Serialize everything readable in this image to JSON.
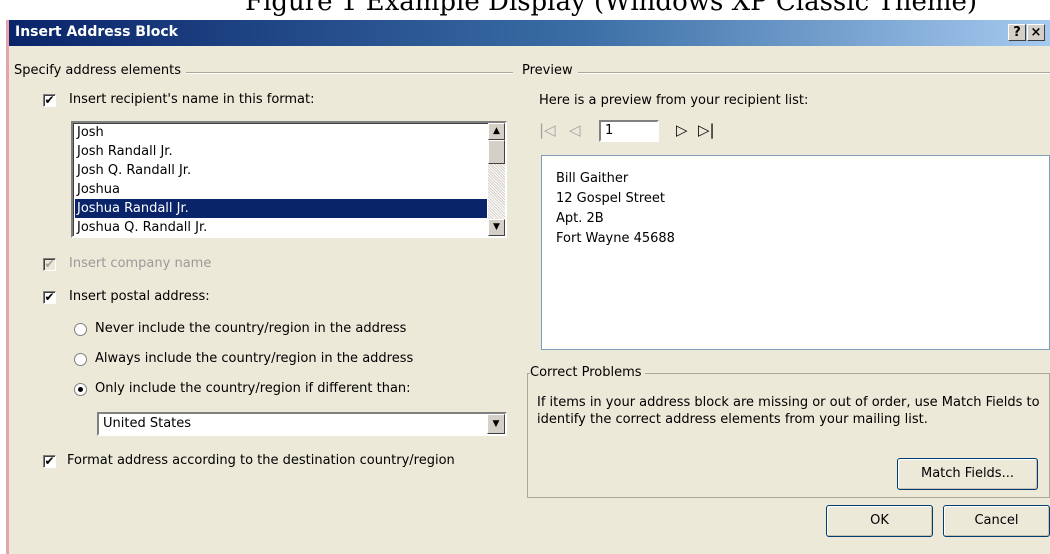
{
  "top_caption": "Figure 1 Example Display (Windows XP Classic Theme)",
  "window": {
    "title": "Insert Address Block",
    "help_button": "?",
    "close_button": "×"
  },
  "elements_group": {
    "label": "Specify address elements",
    "recipient_name_checkbox": {
      "checked": true,
      "label": "Insert recipient's name in this format:"
    },
    "name_formats": [
      "Josh",
      "Josh Randall Jr.",
      "Josh Q. Randall Jr.",
      "Joshua",
      "Joshua Randall Jr.",
      "Joshua Q. Randall Jr."
    ],
    "selected_format": "Joshua Randall Jr.",
    "company_checkbox": {
      "checked": true,
      "enabled": false,
      "label": "Insert company name"
    },
    "postal_checkbox": {
      "checked": true,
      "label": "Insert postal address:"
    },
    "country_options": [
      {
        "label": "Never include the country/region in the address",
        "selected": false
      },
      {
        "label": "Always include the country/region in the address",
        "selected": false
      },
      {
        "label": "Only include the country/region if different than:",
        "selected": true
      }
    ],
    "country_value": "United States",
    "format_checkbox": {
      "checked": true,
      "label": "Format address according to the destination country/region"
    }
  },
  "preview_group": {
    "label": "Preview",
    "intro": "Here is a preview from your recipient list:",
    "record_number": "1",
    "address_lines": [
      "Bill Gaither",
      "12 Gospel Street",
      "Apt. 2B",
      "Fort Wayne 45688"
    ]
  },
  "correct_problems": {
    "label": "Correct Problems",
    "text": "If items in your address block are missing or out of order, use Match Fields to identify the correct address elements from your mailing list.",
    "match_fields_button": "Match Fields..."
  },
  "buttons": {
    "ok": "OK",
    "cancel": "Cancel"
  },
  "icons": {
    "first_record": "first-record-icon",
    "previous_record": "previous-record-icon",
    "next_record": "next-record-icon",
    "last_record": "last-record-icon"
  }
}
